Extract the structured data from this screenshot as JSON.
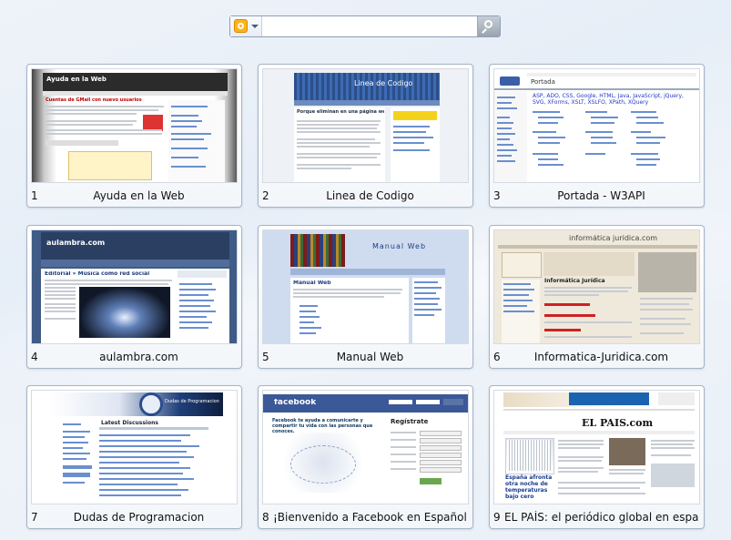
{
  "search": {
    "value": "",
    "placeholder": ""
  },
  "tiles": [
    {
      "number": "1",
      "title": "Ayuda en la Web",
      "thumb_heading": "Ayuda en la Web",
      "thumb_subheading": "Cuentas de GMail con nuevo usuarios"
    },
    {
      "number": "2",
      "title": "Linea de Codigo",
      "thumb_heading": "Linea de Codigo",
      "thumb_subheading": "Porque eliminan en una página web"
    },
    {
      "number": "3",
      "title": "Portada - W3API",
      "thumb_heading": "Portada",
      "thumb_subheading": "ASP, ADO, CSS, Google, HTML, Java, JavaScript, jQuery, SVG, XForms, XSLT, XSLFO, XPath, XQuery"
    },
    {
      "number": "4",
      "title": "aulambra.com",
      "thumb_heading": "aulambra.com",
      "thumb_subheading": "Editorial » Música como red social"
    },
    {
      "number": "5",
      "title": "Manual Web",
      "thumb_heading": "Manual Web",
      "thumb_subheading": "Manual Web"
    },
    {
      "number": "6",
      "title": "Informatica-Juridica.com",
      "thumb_heading": "informática jurídica.com",
      "thumb_subheading": "Informática Jurídica"
    },
    {
      "number": "7",
      "title": "Dudas de Programacion",
      "thumb_heading": "Dudas de Programacion",
      "thumb_subheading": "Latest Discussions"
    },
    {
      "number": "8",
      "title": "¡Bienvenido a Facebook en Español ...",
      "thumb_heading": "facebook",
      "thumb_subheading": "Facebook te ayuda a comunicarte y compartir tu vida con las personas que conoces.",
      "thumb_signup": "Regístrate"
    },
    {
      "number": "9",
      "title": "EL PAÍS: el periódico global en espa...",
      "thumb_heading": "EL PAÍS.com",
      "thumb_subheading": "España afronta otra noche de temperaturas bajo cero"
    }
  ],
  "colors": {
    "accent": "#8e9fb5",
    "search_engine": "#ffb319",
    "go_button": "#9aa3ae"
  }
}
